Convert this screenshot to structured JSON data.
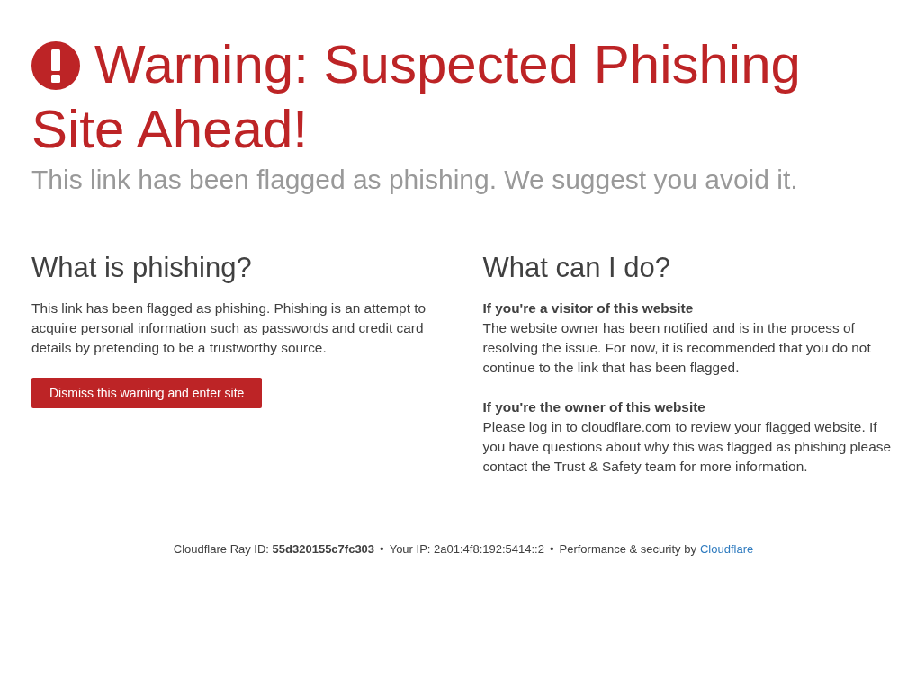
{
  "header": {
    "title_lines": [
      "Warning: Suspected Phishing",
      "Site Ahead!"
    ],
    "subtitle": "This link has been flagged as phishing. We suggest you avoid it."
  },
  "columns": [
    {
      "heading": "What is phishing?",
      "blocks": [
        {
          "kind": "paragraph",
          "text": "This link has been flagged as phishing. Phishing is an attempt to acquire personal information such as passwords and credit card details by pretending to be a trustworthy source."
        },
        {
          "kind": "button",
          "label": "Dismiss this warning and enter site"
        }
      ]
    },
    {
      "heading": "What can I do?",
      "blocks": [
        {
          "kind": "section",
          "title": "If you're a visitor of this website",
          "text": "The website owner has been notified and is in the process of resolving the issue. For now, it is recommended that you do not continue to the link that has been flagged."
        },
        {
          "kind": "section",
          "title": "If you're the owner of this website",
          "text": "Please log in to cloudflare.com to review your flagged website. If you have questions about why this was flagged as phishing please contact the Trust & Safety team for more information."
        }
      ]
    }
  ],
  "footer": {
    "items": [
      {
        "kind": "text",
        "text": "Cloudflare Ray ID: **55d320155c7fc303**"
      },
      {
        "kind": "separator",
        "text": "•"
      },
      {
        "kind": "text",
        "text": "Your IP: 2a01:4f8:192:5414::2"
      },
      {
        "kind": "separator",
        "text": "•"
      },
      {
        "kind": "text",
        "text": "Performance & security by"
      },
      {
        "kind": "link",
        "text": "Cloudflare"
      }
    ]
  }
}
